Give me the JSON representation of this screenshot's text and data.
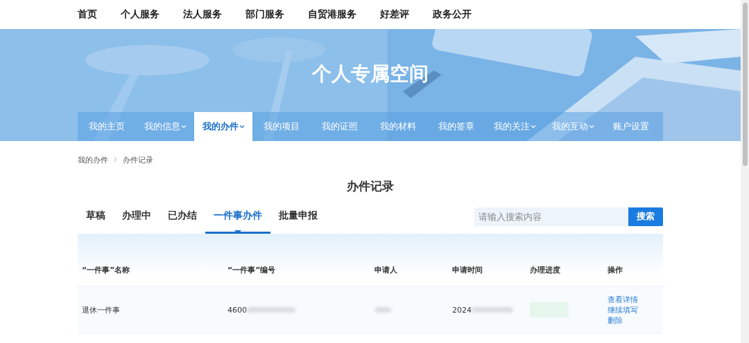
{
  "top_nav": [
    {
      "label": "首页"
    },
    {
      "label": "个人服务"
    },
    {
      "label": "法人服务"
    },
    {
      "label": "部门服务"
    },
    {
      "label": "自贸港服务"
    },
    {
      "label": "好差评"
    },
    {
      "label": "政务公开"
    }
  ],
  "banner": {
    "title": "个人专属空间"
  },
  "space_nav": [
    {
      "label": "我的主页",
      "dropdown": false,
      "selected": false
    },
    {
      "label": "我的信息",
      "dropdown": true,
      "selected": false
    },
    {
      "label": "我的办件",
      "dropdown": true,
      "selected": true
    },
    {
      "label": "我的项目",
      "dropdown": false,
      "selected": false
    },
    {
      "label": "我的证照",
      "dropdown": false,
      "selected": false
    },
    {
      "label": "我的材料",
      "dropdown": false,
      "selected": false
    },
    {
      "label": "我的签章",
      "dropdown": false,
      "selected": false
    },
    {
      "label": "我的关注",
      "dropdown": true,
      "selected": false
    },
    {
      "label": "我的互动",
      "dropdown": true,
      "selected": false
    },
    {
      "label": "账户设置",
      "dropdown": false,
      "selected": false
    }
  ],
  "breadcrumb": [
    "我的办件",
    "办件记录"
  ],
  "page_title": "办件记录",
  "tabs": [
    {
      "label": "草稿",
      "selected": false
    },
    {
      "label": "办理中",
      "selected": false
    },
    {
      "label": "已办结",
      "selected": false
    },
    {
      "label": "一件事办件",
      "selected": true
    },
    {
      "label": "批量申报",
      "selected": false
    }
  ],
  "search": {
    "placeholder": "请输入搜索内容",
    "button": "搜索"
  },
  "table": {
    "columns": [
      "“一件事”名称",
      "“一件事”编号",
      "申请人",
      "申请时间",
      "办理进度",
      "操作"
    ],
    "rows": [
      {
        "name": "退休一件事",
        "number": "4600",
        "time": "2024",
        "actions": [
          "查看详情",
          "继续填写",
          "删除"
        ]
      }
    ]
  }
}
